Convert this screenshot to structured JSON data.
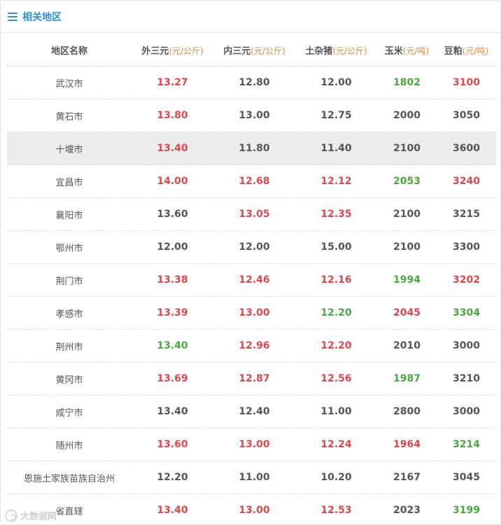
{
  "header": {
    "title": "相关地区",
    "icon": "menu-icon"
  },
  "columns": [
    {
      "label": "地区名称",
      "unit": ""
    },
    {
      "label": "外三元",
      "unit": "(元/公斤)"
    },
    {
      "label": "内三元",
      "unit": "(元/公斤)"
    },
    {
      "label": "土杂猪",
      "unit": "(元/公斤)"
    },
    {
      "label": "玉米",
      "unit": "(元/吨)"
    },
    {
      "label": "豆粕",
      "unit": "(元/吨)"
    }
  ],
  "colors": {
    "up": "#e0474c",
    "down": "#4aa83e",
    "flat": "#555555",
    "accent": "#2e8fd6",
    "unit": "#e8883a"
  },
  "rows": [
    {
      "region": "武汉市",
      "highlight": false,
      "values": [
        "13.27",
        "12.80",
        "12.00",
        "1802",
        "3100"
      ],
      "trend": [
        "up",
        "flat",
        "flat",
        "down",
        "up"
      ]
    },
    {
      "region": "黄石市",
      "highlight": false,
      "values": [
        "13.80",
        "13.00",
        "12.75",
        "2000",
        "3050"
      ],
      "trend": [
        "up",
        "flat",
        "flat",
        "flat",
        "flat"
      ]
    },
    {
      "region": "十堰市",
      "highlight": true,
      "values": [
        "13.40",
        "11.80",
        "11.40",
        "2100",
        "3600"
      ],
      "trend": [
        "up",
        "flat",
        "flat",
        "flat",
        "flat"
      ]
    },
    {
      "region": "宜昌市",
      "highlight": false,
      "values": [
        "14.00",
        "12.68",
        "12.12",
        "2053",
        "3240"
      ],
      "trend": [
        "up",
        "up",
        "up",
        "down",
        "up"
      ]
    },
    {
      "region": "襄阳市",
      "highlight": false,
      "values": [
        "13.60",
        "13.05",
        "12.35",
        "2100",
        "3215"
      ],
      "trend": [
        "flat",
        "up",
        "up",
        "flat",
        "flat"
      ]
    },
    {
      "region": "鄂州市",
      "highlight": false,
      "values": [
        "12.00",
        "12.00",
        "15.00",
        "2100",
        "3300"
      ],
      "trend": [
        "flat",
        "flat",
        "flat",
        "flat",
        "flat"
      ]
    },
    {
      "region": "荆门市",
      "highlight": false,
      "values": [
        "13.38",
        "12.46",
        "12.16",
        "1994",
        "3202"
      ],
      "trend": [
        "up",
        "up",
        "up",
        "down",
        "up"
      ]
    },
    {
      "region": "孝感市",
      "highlight": false,
      "values": [
        "13.39",
        "13.00",
        "12.20",
        "2045",
        "3304"
      ],
      "trend": [
        "up",
        "up",
        "down",
        "up",
        "down"
      ]
    },
    {
      "region": "荆州市",
      "highlight": false,
      "values": [
        "13.40",
        "12.96",
        "12.20",
        "2010",
        "3000"
      ],
      "trend": [
        "down",
        "up",
        "up",
        "flat",
        "flat"
      ]
    },
    {
      "region": "黄冈市",
      "highlight": false,
      "values": [
        "13.69",
        "12.87",
        "12.56",
        "1987",
        "3210"
      ],
      "trend": [
        "up",
        "up",
        "up",
        "down",
        "flat"
      ]
    },
    {
      "region": "咸宁市",
      "highlight": false,
      "values": [
        "13.40",
        "12.40",
        "11.00",
        "2800",
        "3000"
      ],
      "trend": [
        "flat",
        "flat",
        "flat",
        "flat",
        "flat"
      ]
    },
    {
      "region": "随州市",
      "highlight": false,
      "values": [
        "13.60",
        "13.00",
        "12.24",
        "1964",
        "3214"
      ],
      "trend": [
        "up",
        "up",
        "up",
        "up",
        "down"
      ]
    },
    {
      "region": "恩施土家族苗族自治州",
      "highlight": false,
      "values": [
        "12.20",
        "11.00",
        "10.20",
        "2167",
        "3045"
      ],
      "trend": [
        "flat",
        "flat",
        "flat",
        "flat",
        "flat"
      ]
    },
    {
      "region": "省直辖",
      "highlight": false,
      "values": [
        "13.40",
        "13.00",
        "12.53",
        "2023",
        "3199"
      ],
      "trend": [
        "up",
        "up",
        "up",
        "flat",
        "down"
      ]
    }
  ],
  "watermark": {
    "text": "大数据网",
    "icon": "logo-icon"
  }
}
